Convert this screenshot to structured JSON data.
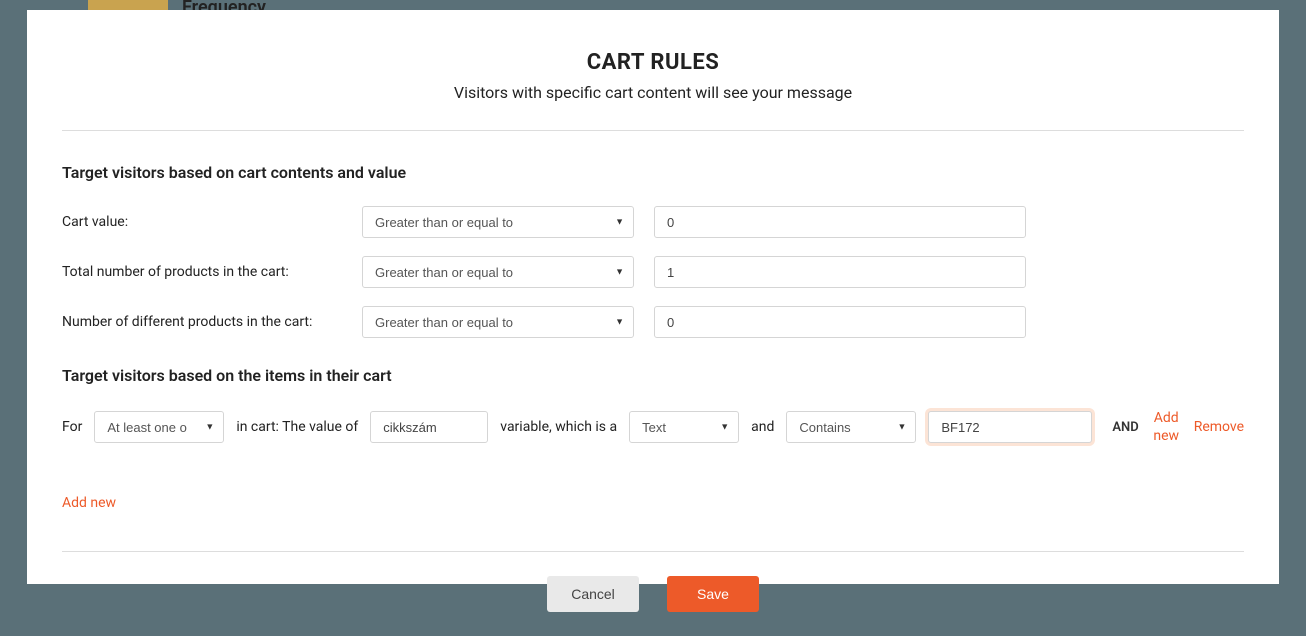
{
  "background": {
    "truncated_heading": "Frequency"
  },
  "modal": {
    "title": "CART RULES",
    "subtitle": "Visitors with specific cart content will see your message"
  },
  "section1": {
    "heading": "Target visitors based on cart contents and value",
    "rows": [
      {
        "label": "Cart value:",
        "operator": "Greater than or equal to",
        "value": "0"
      },
      {
        "label": "Total number of products in the cart:",
        "operator": "Greater than or equal to",
        "value": "1"
      },
      {
        "label": "Number of different products in the cart:",
        "operator": "Greater than or equal to",
        "value": "0"
      }
    ]
  },
  "section2": {
    "heading": "Target visitors based on the items in their cart",
    "rule": {
      "for_label": "For",
      "quantifier": "At least one o",
      "in_cart_label": "in cart: The value of",
      "variable": "cikkszám",
      "variable_label": "variable, which is a",
      "type": "Text",
      "and_label": "and",
      "operator": "Contains",
      "value": "BF172",
      "conj": "AND",
      "add_new": "Add new",
      "remove": "Remove"
    },
    "add_new": "Add new"
  },
  "footer": {
    "cancel": "Cancel",
    "save": "Save"
  }
}
